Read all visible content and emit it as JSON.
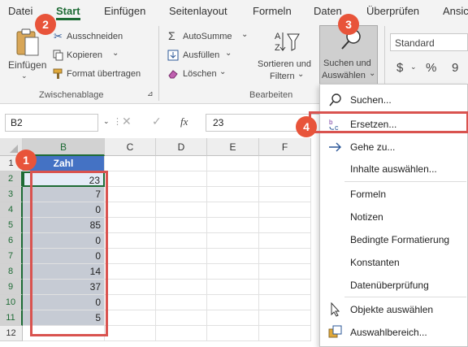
{
  "tabs": [
    "Datei",
    "Start",
    "Einfügen",
    "Seitenlayout",
    "Formeln",
    "Daten",
    "Überprüfen",
    "Ansicht"
  ],
  "active_tab": "Start",
  "ribbon": {
    "clipboard": {
      "paste": "Einfügen",
      "cut": "Ausschneiden",
      "copy": "Kopieren",
      "format_painter": "Format übertragen",
      "group_label": "Zwischenablage"
    },
    "editing": {
      "autosum": "AutoSumme",
      "fill": "Ausfüllen",
      "clear": "Löschen",
      "sort_filter_1": "Sortieren und",
      "sort_filter_2": "Filtern",
      "find_select_1": "Suchen und",
      "find_select_2": "Auswählen",
      "group_label": "Bearbeiten"
    },
    "number": {
      "format": "Standard",
      "currency": "$",
      "percent": "%",
      "comma": "9"
    }
  },
  "formula_bar": {
    "name_box": "B2",
    "fx": "fx",
    "value": "23"
  },
  "columns": [
    "B",
    "C",
    "D",
    "E",
    "F"
  ],
  "rows": [
    "1",
    "2",
    "3",
    "4",
    "5",
    "6",
    "7",
    "8",
    "9",
    "10",
    "11",
    "12"
  ],
  "table": {
    "header": "Zahl",
    "values": [
      "23",
      "7",
      "0",
      "85",
      "0",
      "0",
      "14",
      "37",
      "0",
      "5"
    ]
  },
  "menu": {
    "items": [
      {
        "label": "Suchen...",
        "icon": "magnifier-icon"
      },
      {
        "label": "Ersetzen...",
        "icon": "replace-icon"
      },
      {
        "label": "Gehe zu...",
        "icon": "arrow-right-icon"
      },
      {
        "label": "Inhalte auswählen...",
        "icon": ""
      },
      {
        "label": "Formeln",
        "icon": ""
      },
      {
        "label": "Notizen",
        "icon": ""
      },
      {
        "label": "Bedingte Formatierung",
        "icon": ""
      },
      {
        "label": "Konstanten",
        "icon": ""
      },
      {
        "label": "Datenüberprüfung",
        "icon": ""
      },
      {
        "label": "Objekte auswählen",
        "icon": "pointer-icon"
      },
      {
        "label": "Auswahlbereich...",
        "icon": "selection-pane-icon"
      }
    ]
  },
  "badges": [
    "1",
    "2",
    "3",
    "4"
  ],
  "colors": {
    "excel_green": "#1e6b35",
    "header_blue": "#4472c4",
    "callout_red": "#e8543a",
    "highlight_red": "#d9534f"
  }
}
